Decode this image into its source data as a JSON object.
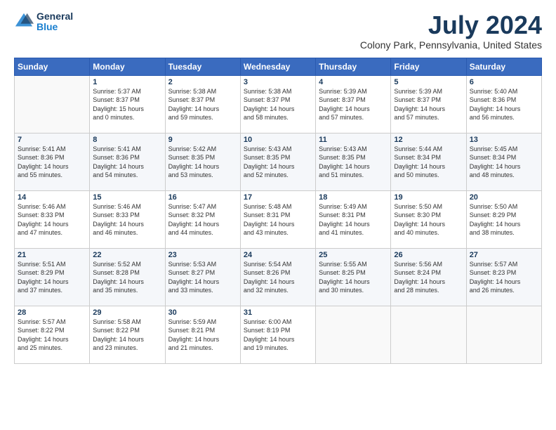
{
  "logo": {
    "general": "General",
    "blue": "Blue"
  },
  "title": "July 2024",
  "location": "Colony Park, Pennsylvania, United States",
  "days_of_week": [
    "Sunday",
    "Monday",
    "Tuesday",
    "Wednesday",
    "Thursday",
    "Friday",
    "Saturday"
  ],
  "weeks": [
    [
      {
        "day": "",
        "content": ""
      },
      {
        "day": "1",
        "content": "Sunrise: 5:37 AM\nSunset: 8:37 PM\nDaylight: 15 hours\nand 0 minutes."
      },
      {
        "day": "2",
        "content": "Sunrise: 5:38 AM\nSunset: 8:37 PM\nDaylight: 14 hours\nand 59 minutes."
      },
      {
        "day": "3",
        "content": "Sunrise: 5:38 AM\nSunset: 8:37 PM\nDaylight: 14 hours\nand 58 minutes."
      },
      {
        "day": "4",
        "content": "Sunrise: 5:39 AM\nSunset: 8:37 PM\nDaylight: 14 hours\nand 57 minutes."
      },
      {
        "day": "5",
        "content": "Sunrise: 5:39 AM\nSunset: 8:37 PM\nDaylight: 14 hours\nand 57 minutes."
      },
      {
        "day": "6",
        "content": "Sunrise: 5:40 AM\nSunset: 8:36 PM\nDaylight: 14 hours\nand 56 minutes."
      }
    ],
    [
      {
        "day": "7",
        "content": "Sunrise: 5:41 AM\nSunset: 8:36 PM\nDaylight: 14 hours\nand 55 minutes."
      },
      {
        "day": "8",
        "content": "Sunrise: 5:41 AM\nSunset: 8:36 PM\nDaylight: 14 hours\nand 54 minutes."
      },
      {
        "day": "9",
        "content": "Sunrise: 5:42 AM\nSunset: 8:35 PM\nDaylight: 14 hours\nand 53 minutes."
      },
      {
        "day": "10",
        "content": "Sunrise: 5:43 AM\nSunset: 8:35 PM\nDaylight: 14 hours\nand 52 minutes."
      },
      {
        "day": "11",
        "content": "Sunrise: 5:43 AM\nSunset: 8:35 PM\nDaylight: 14 hours\nand 51 minutes."
      },
      {
        "day": "12",
        "content": "Sunrise: 5:44 AM\nSunset: 8:34 PM\nDaylight: 14 hours\nand 50 minutes."
      },
      {
        "day": "13",
        "content": "Sunrise: 5:45 AM\nSunset: 8:34 PM\nDaylight: 14 hours\nand 48 minutes."
      }
    ],
    [
      {
        "day": "14",
        "content": "Sunrise: 5:46 AM\nSunset: 8:33 PM\nDaylight: 14 hours\nand 47 minutes."
      },
      {
        "day": "15",
        "content": "Sunrise: 5:46 AM\nSunset: 8:33 PM\nDaylight: 14 hours\nand 46 minutes."
      },
      {
        "day": "16",
        "content": "Sunrise: 5:47 AM\nSunset: 8:32 PM\nDaylight: 14 hours\nand 44 minutes."
      },
      {
        "day": "17",
        "content": "Sunrise: 5:48 AM\nSunset: 8:31 PM\nDaylight: 14 hours\nand 43 minutes."
      },
      {
        "day": "18",
        "content": "Sunrise: 5:49 AM\nSunset: 8:31 PM\nDaylight: 14 hours\nand 41 minutes."
      },
      {
        "day": "19",
        "content": "Sunrise: 5:50 AM\nSunset: 8:30 PM\nDaylight: 14 hours\nand 40 minutes."
      },
      {
        "day": "20",
        "content": "Sunrise: 5:50 AM\nSunset: 8:29 PM\nDaylight: 14 hours\nand 38 minutes."
      }
    ],
    [
      {
        "day": "21",
        "content": "Sunrise: 5:51 AM\nSunset: 8:29 PM\nDaylight: 14 hours\nand 37 minutes."
      },
      {
        "day": "22",
        "content": "Sunrise: 5:52 AM\nSunset: 8:28 PM\nDaylight: 14 hours\nand 35 minutes."
      },
      {
        "day": "23",
        "content": "Sunrise: 5:53 AM\nSunset: 8:27 PM\nDaylight: 14 hours\nand 33 minutes."
      },
      {
        "day": "24",
        "content": "Sunrise: 5:54 AM\nSunset: 8:26 PM\nDaylight: 14 hours\nand 32 minutes."
      },
      {
        "day": "25",
        "content": "Sunrise: 5:55 AM\nSunset: 8:25 PM\nDaylight: 14 hours\nand 30 minutes."
      },
      {
        "day": "26",
        "content": "Sunrise: 5:56 AM\nSunset: 8:24 PM\nDaylight: 14 hours\nand 28 minutes."
      },
      {
        "day": "27",
        "content": "Sunrise: 5:57 AM\nSunset: 8:23 PM\nDaylight: 14 hours\nand 26 minutes."
      }
    ],
    [
      {
        "day": "28",
        "content": "Sunrise: 5:57 AM\nSunset: 8:22 PM\nDaylight: 14 hours\nand 25 minutes."
      },
      {
        "day": "29",
        "content": "Sunrise: 5:58 AM\nSunset: 8:22 PM\nDaylight: 14 hours\nand 23 minutes."
      },
      {
        "day": "30",
        "content": "Sunrise: 5:59 AM\nSunset: 8:21 PM\nDaylight: 14 hours\nand 21 minutes."
      },
      {
        "day": "31",
        "content": "Sunrise: 6:00 AM\nSunset: 8:19 PM\nDaylight: 14 hours\nand 19 minutes."
      },
      {
        "day": "",
        "content": ""
      },
      {
        "day": "",
        "content": ""
      },
      {
        "day": "",
        "content": ""
      }
    ]
  ]
}
